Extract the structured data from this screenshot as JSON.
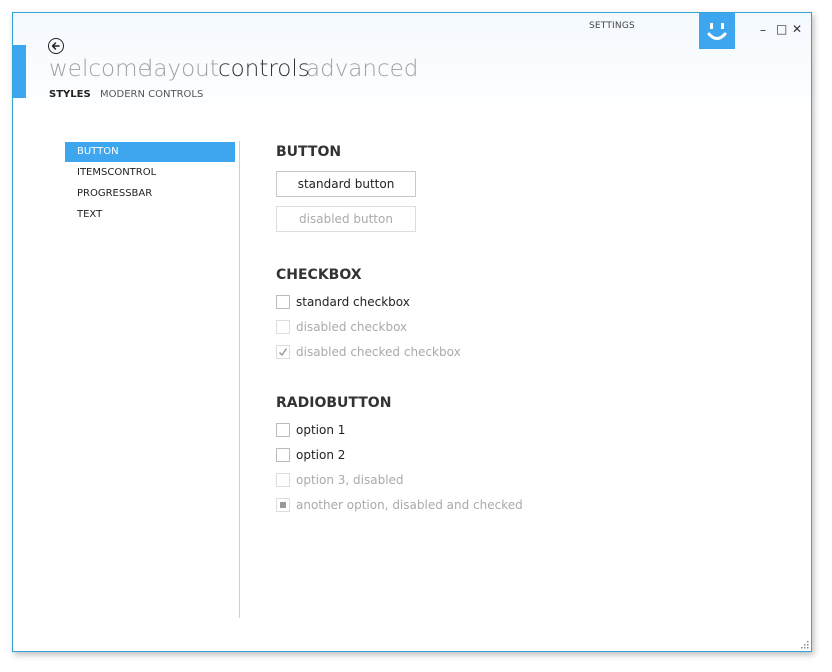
{
  "window": {
    "title": "SETTINGS",
    "controls": {
      "minimize": "–",
      "maximize": "□",
      "close": "✕"
    }
  },
  "nav": {
    "items": [
      {
        "label": "welcome",
        "active": false
      },
      {
        "label": "layout",
        "active": false
      },
      {
        "label": "controls",
        "active": true
      },
      {
        "label": "advanced",
        "active": false
      }
    ]
  },
  "subnav": {
    "items": [
      {
        "label": "STYLES",
        "active": true
      },
      {
        "label": "MODERN CONTROLS",
        "active": false
      }
    ]
  },
  "sidebar": {
    "items": [
      {
        "label": "BUTTON",
        "selected": true
      },
      {
        "label": "ITEMSCONTROL",
        "selected": false
      },
      {
        "label": "PROGRESSBAR",
        "selected": false
      },
      {
        "label": "TEXT",
        "selected": false
      }
    ]
  },
  "sections": {
    "button": {
      "heading": "BUTTON",
      "standard": "standard button",
      "disabled": "disabled button"
    },
    "checkbox": {
      "heading": "CHECKBOX",
      "items": [
        {
          "label": "standard checkbox",
          "checked": false,
          "disabled": false
        },
        {
          "label": "disabled checkbox",
          "checked": false,
          "disabled": true
        },
        {
          "label": "disabled checked checkbox",
          "checked": true,
          "disabled": true
        }
      ]
    },
    "radiobutton": {
      "heading": "RADIOBUTTON",
      "items": [
        {
          "label": "option 1",
          "checked": false,
          "disabled": false
        },
        {
          "label": "option 2",
          "checked": false,
          "disabled": false
        },
        {
          "label": "option 3, disabled",
          "checked": false,
          "disabled": true
        },
        {
          "label": "another option, disabled and checked",
          "checked": true,
          "disabled": true
        }
      ]
    }
  },
  "colors": {
    "accent": "#3ea5ef",
    "frame": "#34a3d6"
  }
}
